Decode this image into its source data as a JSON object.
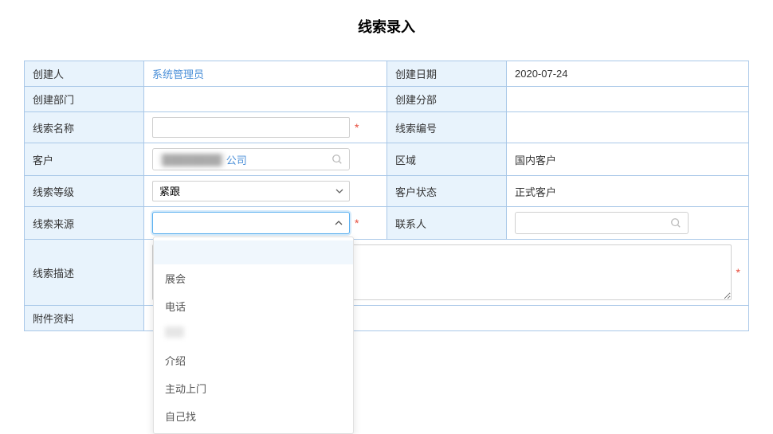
{
  "title": "线索录入",
  "rows": {
    "creator": {
      "label": "创建人",
      "value": "系统管理员"
    },
    "create_date": {
      "label": "创建日期",
      "value": "2020-07-24"
    },
    "create_dept": {
      "label": "创建部门",
      "value": ""
    },
    "create_branch": {
      "label": "创建分部",
      "value": ""
    },
    "lead_name": {
      "label": "线索名称",
      "value": ""
    },
    "lead_no": {
      "label": "线索编号",
      "value": ""
    },
    "customer": {
      "label": "客户",
      "value_suffix": "公司"
    },
    "region": {
      "label": "区域",
      "value": "国内客户"
    },
    "lead_level": {
      "label": "线索等级",
      "value": "紧跟"
    },
    "customer_status": {
      "label": "客户状态",
      "value": "正式客户"
    },
    "lead_source": {
      "label": "线索来源",
      "value": ""
    },
    "contact": {
      "label": "联系人",
      "value": ""
    },
    "lead_desc": {
      "label": "线索描述",
      "value": ""
    },
    "attachments": {
      "label": "附件资料",
      "value": ""
    }
  },
  "source_options": [
    "",
    "展会",
    "电话",
    "",
    "介绍",
    "主动上门",
    "自己找"
  ]
}
